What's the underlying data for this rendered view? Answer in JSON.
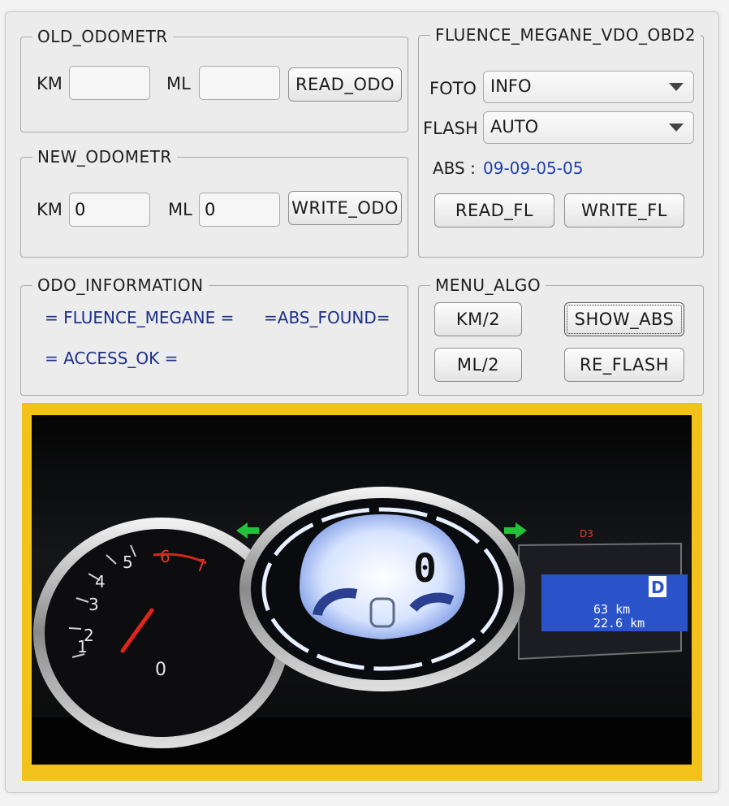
{
  "old_odometer": {
    "legend": "OLD_ODOMETR",
    "km_label": "KM",
    "km_value": "",
    "ml_label": "ML",
    "ml_value": "",
    "read_button": "READ_ODO"
  },
  "new_odometer": {
    "legend": "NEW_ODOMETR",
    "km_label": "KM",
    "km_value": "0",
    "ml_label": "ML",
    "ml_value": "0",
    "write_button": "WRITE_ODO"
  },
  "device": {
    "legend": "FLUENCE_MEGANE_VDO_OBD2",
    "foto_label": "FOTO",
    "foto_value": "INFO",
    "flash_label": "FLASH",
    "flash_value": "AUTO",
    "abs_label": "ABS :",
    "abs_value": "09-09-05-05",
    "read_button": "READ_FL",
    "write_button": "WRITE_FL"
  },
  "odo_information": {
    "legend": "ODO_INFORMATION",
    "line1": "= FLUENCE_MEGANE =",
    "line2": "=ABS_FOUND=",
    "line3": "= ACCESS_OK ="
  },
  "menu_algo": {
    "legend": "MENU_ALGO",
    "km_half": "KM/2",
    "show_abs": "SHOW_ABS",
    "ml_half": "ML/2",
    "re_flash": "RE_FLASH"
  },
  "dashboard": {
    "tacho_ticks": [
      "0",
      "1",
      "2",
      "3",
      "4",
      "5",
      "6",
      "7"
    ],
    "gear": "D",
    "speed_digit": "0",
    "odo_line1": "63  km",
    "odo_line2": "22.6 km",
    "indicator": "D3",
    "colors": {
      "frame": "#f2c21b",
      "lcd_blue": "#c9d9ff",
      "trip_blue": "#2a53c9",
      "arrow_green": "#23c23a",
      "needle_red": "#e0241b"
    }
  }
}
